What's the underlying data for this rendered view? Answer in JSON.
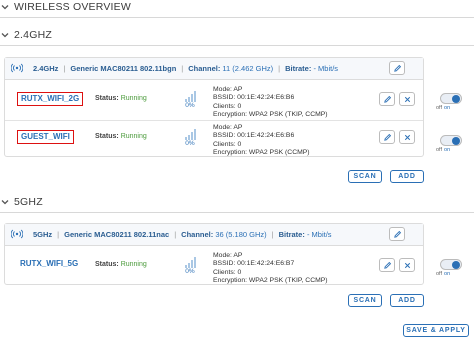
{
  "page": {
    "title": "WIRELESS OVERVIEW"
  },
  "sections": [
    {
      "label": "2.4GHZ",
      "radio": {
        "band": "2.4GHz",
        "model": "Generic MAC80211 802.11bgn",
        "channel_label": "Channel:",
        "channel_value": "11 (2.462 GHz)",
        "bitrate_label": "Bitrate:",
        "bitrate_value": "- Mbit/s"
      },
      "interfaces": [
        {
          "ssid": "RUTX_WIFI_2G",
          "highlighted": true,
          "status_label": "Status:",
          "status_value": "Running",
          "signal": "0%",
          "mode": "Mode: AP",
          "bssid": "BSSID: 00:1E:42:24:E6:B6",
          "clients": "Clients: 0",
          "encryption": "Encryption: WPA2 PSK (TKIP, CCMP)",
          "toggle_off": "off",
          "toggle_on": "on"
        },
        {
          "ssid": "GUEST_WIFI",
          "highlighted": true,
          "status_label": "Status:",
          "status_value": "Running",
          "signal": "0%",
          "mode": "Mode: AP",
          "bssid": "BSSID: 00:1E:42:24:E6:B6",
          "clients": "Clients: 0",
          "encryption": "Encryption: WPA2 PSK (CCMP)",
          "toggle_off": "off",
          "toggle_on": "on"
        }
      ],
      "scan_label": "SCAN",
      "add_label": "ADD"
    },
    {
      "label": "5GHZ",
      "radio": {
        "band": "5GHz",
        "model": "Generic MAC80211 802.11nac",
        "channel_label": "Channel:",
        "channel_value": "36 (5.180 GHz)",
        "bitrate_label": "Bitrate:",
        "bitrate_value": "- Mbit/s"
      },
      "interfaces": [
        {
          "ssid": "RUTX_WIFI_5G",
          "highlighted": false,
          "status_label": "Status:",
          "status_value": "Running",
          "signal": "0%",
          "mode": "Mode: AP",
          "bssid": "BSSID: 00:1E:42:24:E6:B7",
          "clients": "Clients: 0",
          "encryption": "Encryption: WPA2 PSK (TKIP, CCMP)",
          "toggle_off": "off",
          "toggle_on": "on"
        }
      ],
      "scan_label": "SCAN",
      "add_label": "ADD"
    }
  ],
  "footer": {
    "save_apply_label": "SAVE & APPLY"
  },
  "colors": {
    "accent": "#2a6fb5",
    "running": "#4a9a3a",
    "highlight_box": "#dd1111"
  },
  "icons": {
    "collapse": "chevron-down-icon",
    "radio": "wifi-icon",
    "edit": "pencil-icon",
    "delete": "close-icon"
  }
}
